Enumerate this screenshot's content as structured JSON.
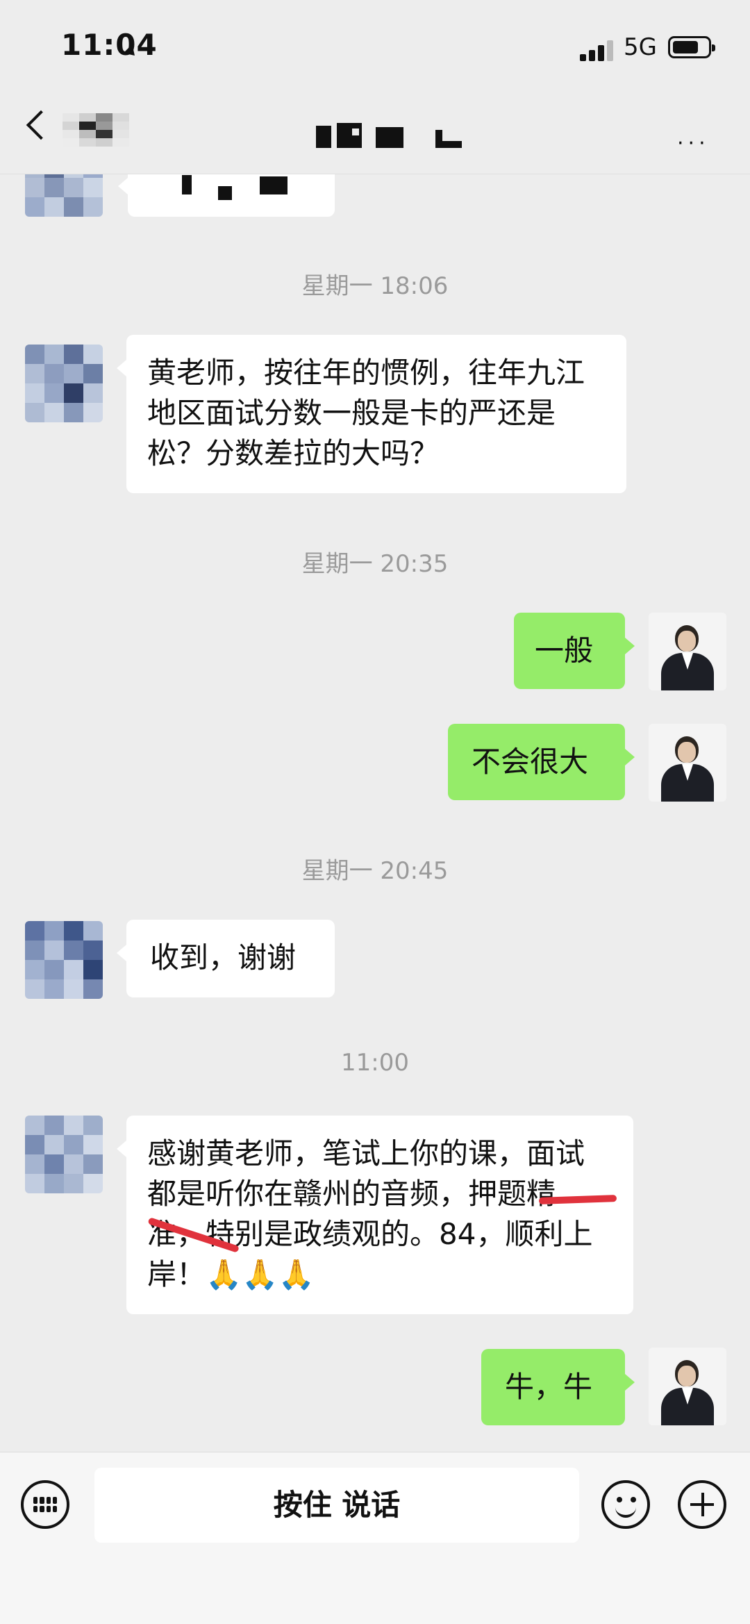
{
  "status_bar": {
    "time": "11:04",
    "network": "5G"
  },
  "header": {
    "more_label": "···"
  },
  "timestamps": [
    "星期一 18:06",
    "星期一 20:35",
    "星期一 20:45",
    "11:00"
  ],
  "messages": [
    {
      "side": "in",
      "text": "​黄老师，按往年的惯例，往年九江地区面试分数一般是卡的严还是松？分数差拉的大吗？"
    },
    {
      "side": "out",
      "text": "一般"
    },
    {
      "side": "out",
      "text": "不会很大"
    },
    {
      "side": "in",
      "text": "收到，谢谢"
    },
    {
      "side": "in",
      "text": "感谢黄老师，笔试上你的课，面试都是听你在赣州的音频，押题精准，特别是政绩观的。84，顺利上岸！🙏🙏🙏"
    },
    {
      "side": "out",
      "text": "牛，牛"
    }
  ],
  "input_bar": {
    "talk_label": "按住 说话"
  },
  "colors": {
    "background": "#ededed",
    "outgoing_bubble": "#95ec69",
    "incoming_bubble": "#ffffff",
    "highlight_underline": "#e0323c"
  },
  "icons": [
    "back-chevron-icon",
    "more-dots-icon",
    "keyboard-icon",
    "emoji-icon",
    "plus-icon"
  ]
}
